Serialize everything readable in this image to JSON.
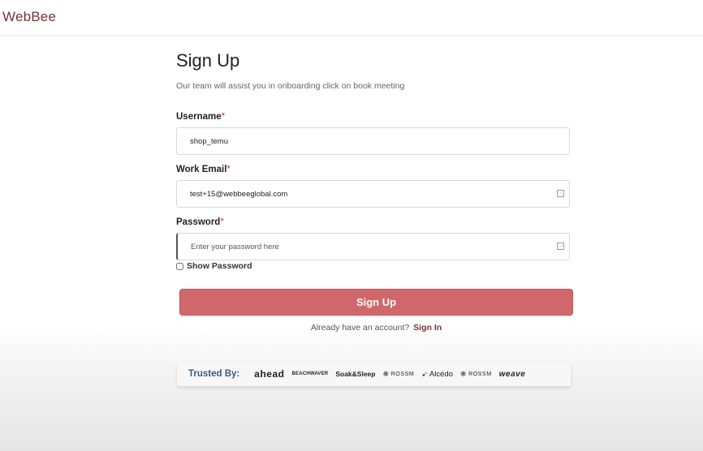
{
  "header": {
    "logo_text": "WebBee",
    "brand_color": "#7d2f37"
  },
  "form": {
    "title": "Sign Up",
    "subtitle": "Our team will assist you in onboarding click on book meeting",
    "username": {
      "label": "Username",
      "required_mark": "*",
      "value": "shop_temu"
    },
    "email": {
      "label": "Work Email",
      "required_mark": "*",
      "value": "test+15@webbeeglobal.com",
      "icon": "autofill-icon"
    },
    "password": {
      "label": "Password",
      "required_mark": "*",
      "value": "",
      "placeholder": "Enter your password here",
      "icon": "autofill-icon"
    },
    "show_password_label": "Show Password",
    "show_password_checked": false,
    "submit_label": "Sign Up",
    "submit_color": "#d0686b",
    "signin_prompt": "Already have an account?",
    "signin_link": "Sign In"
  },
  "trusted": {
    "label": "Trusted By:",
    "label_color": "#3b5b7a",
    "brands": [
      "ahead",
      "BEACHWAVER",
      "Soak&Sleep",
      "ROSSM",
      "Alcédo",
      "ROSSM",
      "weave"
    ]
  }
}
